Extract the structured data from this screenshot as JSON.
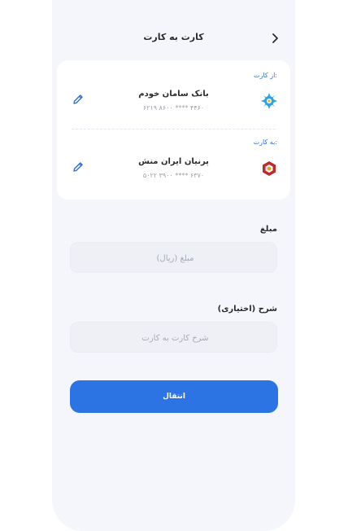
{
  "header": {
    "title": "کارت به کارت"
  },
  "from": {
    "label": "از کارت:",
    "bank_name": "بانک سامان خودم",
    "card_number": "۶۲۱۹ ۸۶۰۰ **** ۴۴۶۰"
  },
  "to": {
    "label": "به کارت:",
    "bank_name": "پرنیان ایران منش",
    "card_number": "۵۰۲۲ ۳۹۰۰ **** ۶۳۷۰"
  },
  "amount": {
    "label": "مبلغ",
    "placeholder": "مبلغ (ریال)"
  },
  "description": {
    "label": "شرح (اختیاری)",
    "placeholder": "شرح کارت به کارت"
  },
  "actions": {
    "submit_label": "انتقال"
  },
  "colors": {
    "accent": "#2c73e3",
    "background": "#f5f6fb"
  }
}
